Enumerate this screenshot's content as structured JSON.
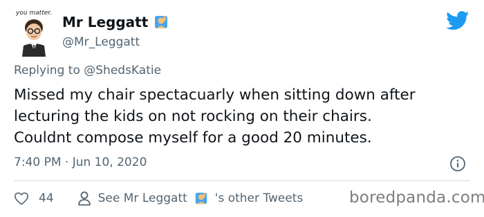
{
  "author": {
    "avatar_label": "you matter.",
    "display_name": "Mr Leggatt",
    "name_emoji": "raising-hand-emoji",
    "handle": "@Mr_Leggatt"
  },
  "reply": {
    "prefix": "Replying to",
    "mention": "@ShedsKatie"
  },
  "tweet": {
    "text": "Missed my chair spectacuarly when sitting down after\nlecturing the kids on not rocking on their chairs.\nCouldnt compose myself for a good 20 minutes."
  },
  "meta": {
    "timestamp": "7:40 PM · Jun 10, 2020"
  },
  "footer": {
    "like_count": "44",
    "see_prefix": "See Mr Leggatt",
    "see_suffix": "'s other Tweets"
  },
  "watermark": "boredpanda.com",
  "colors": {
    "twitter_blue": "#1d9bf0",
    "secondary_text": "#536471"
  },
  "icons": [
    "twitter-bird-icon",
    "info-icon",
    "heart-icon",
    "person-icon",
    "raising-hand-emoji"
  ]
}
